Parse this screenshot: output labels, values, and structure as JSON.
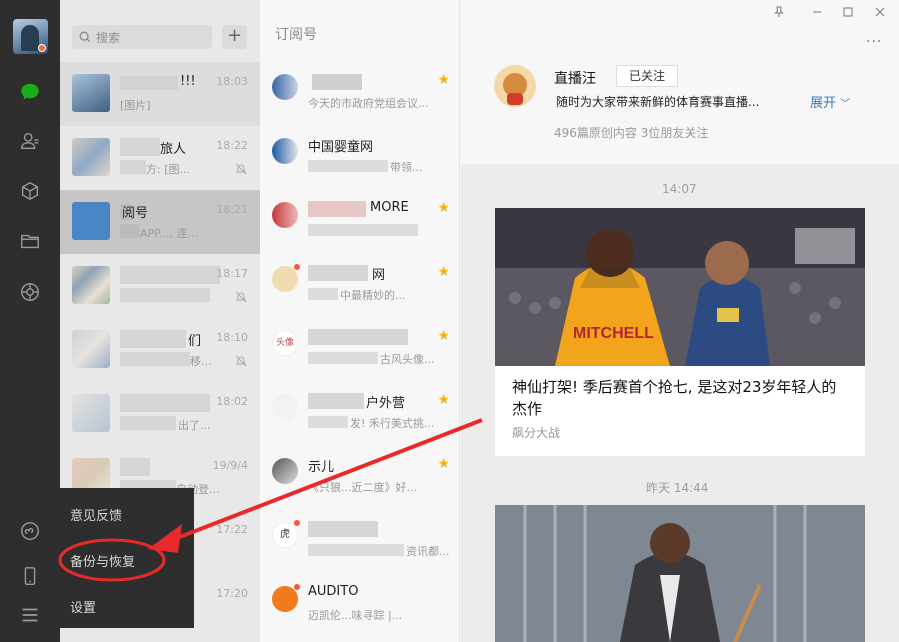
{
  "window": {
    "controls": [
      "pin-icon",
      "minimize-icon",
      "maximize-icon",
      "close-icon"
    ],
    "more_label": "···"
  },
  "rail": {
    "icons": [
      "chat-icon",
      "contacts-icon",
      "favorites-icon",
      "files-icon",
      "moments-icon",
      "miniprogram-icon",
      "phone-icon",
      "menu-icon"
    ]
  },
  "search": {
    "placeholder": "搜索",
    "add_label": "+"
  },
  "chats": [
    {
      "name": "!!!",
      "msg": "[图片]",
      "time": "18:03"
    },
    {
      "name": "旅人",
      "msg": "方: [图...",
      "time": "18:22"
    },
    {
      "name": "阅号",
      "msg": "APP..., 连...",
      "time": "18:21"
    },
    {
      "name": "",
      "msg": "",
      "time": "18:17"
    },
    {
      "name": "们",
      "msg": "移...",
      "time": "18:10"
    },
    {
      "name": "",
      "msg": "出了...",
      "time": "18:02"
    },
    {
      "name": "",
      "msg": "自动登...",
      "time": "19/9/4"
    },
    {
      "name": "",
      "msg": "",
      "time": "17:22"
    },
    {
      "name": "",
      "msg": "",
      "time": "17:20"
    }
  ],
  "popup": {
    "items": [
      "意见反馈",
      "备份与恢复",
      "设置"
    ]
  },
  "subscriptions": {
    "header": "订阅号",
    "items": [
      {
        "name": "",
        "msg": "今天的市政府党组会议..."
      },
      {
        "name": "中国婴童网",
        "msg": "带领..."
      },
      {
        "name": "MORE",
        "msg": ""
      },
      {
        "name": "网",
        "msg": "中最精妙的..."
      },
      {
        "name": "",
        "msg": "古风头像..."
      },
      {
        "name": "户外营",
        "msg": "发! 禾行美式挑..."
      },
      {
        "name": "示儿",
        "msg": "《只狼...近二度》好..."
      },
      {
        "name": "",
        "msg": "资讯都..."
      },
      {
        "name": "AUDITO",
        "msg": "迈凯伦...味寻踪 |..."
      }
    ]
  },
  "profile": {
    "name": "直播汪",
    "follow_label": "已关注",
    "description": "随时为大家带来新鲜的体育赛事直播...",
    "expand_label": "展开",
    "stats": "496篇原创内容  3位朋友关注"
  },
  "feed": {
    "time1": "14:07",
    "article1_title": "神仙打架! 季后赛首个抢七, 是这对23岁年轻人的杰作",
    "article1_source": "飙分大战",
    "article1_jersey": "MITCHELL",
    "time2": "昨天 14:44"
  },
  "colors": {
    "rail_bg": "#2e2e2e",
    "chat_green": "#1aad19",
    "star": "#f7b500",
    "annotation_red": "#e82a2a",
    "link_blue": "#3a75c4"
  }
}
